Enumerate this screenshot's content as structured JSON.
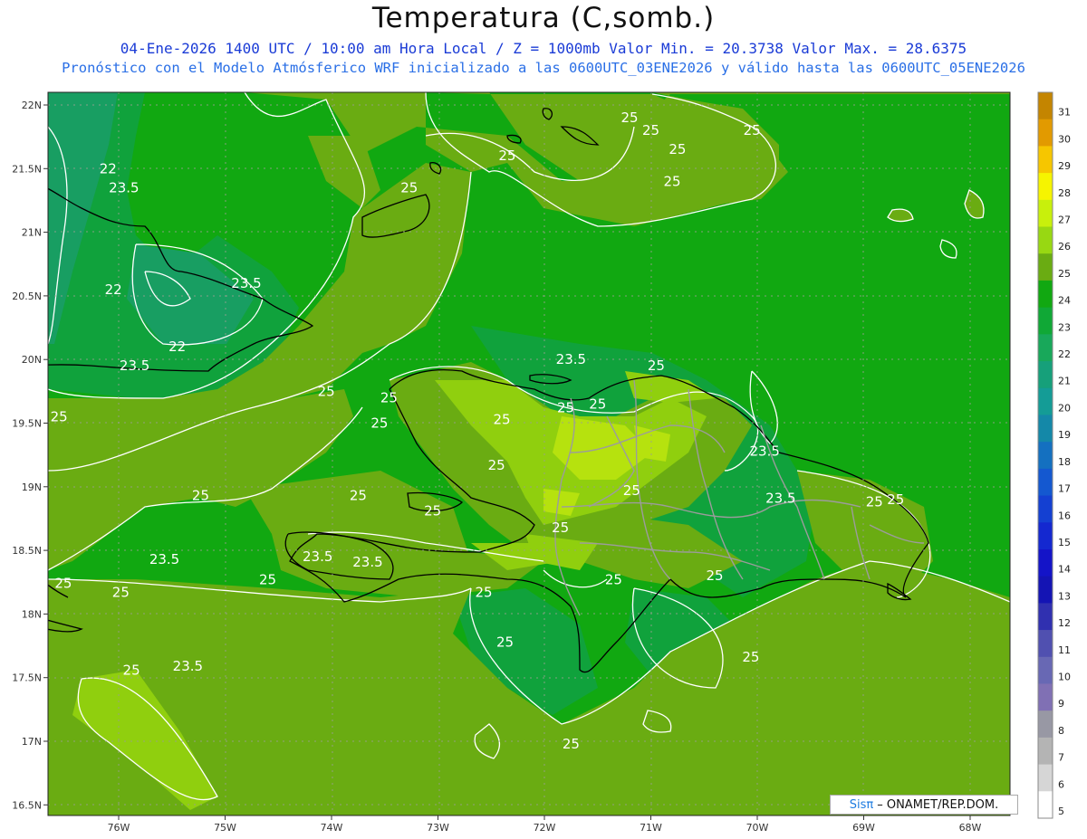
{
  "title": "Temperatura (C,somb.)",
  "subtitle_line1": "04-Ene-2026 1400 UTC / 10:00 am Hora Local / Z = 1000mb  Valor Min. = 20.3738  Valor Max. = 28.6375",
  "subtitle_line2": "Pronóstico con el Modelo Atmósferico WRF inicializado a las 0600UTC_03ENE2026 y válido hasta las  0600UTC_05ENE2026",
  "credit": {
    "sis": "Sisπ",
    "org": "– ONAMET/REP.DOM."
  },
  "colors": {
    "bg_24": "#11a811",
    "band_23": "#0fa23a",
    "band_22": "#169e5c",
    "band_25": "#6aac12",
    "band_26": "#8ccd0c",
    "band_27": "#b4e30c",
    "contour": "#ffffff",
    "coast": "#000000",
    "border": "#a0a0a0"
  },
  "chart_data": {
    "type": "heatmap",
    "variable": "Temperatura",
    "units": "C",
    "level": "1000mb",
    "valid_time": "04-Ene-2026 1400 UTC",
    "min_value": 20.3738,
    "max_value": 28.6375,
    "lon_range": [
      -76.6,
      -67.6
    ],
    "lat_range": [
      16.4,
      22.1
    ],
    "x_ticks": [
      "76W",
      "75W",
      "74W",
      "73W",
      "72W",
      "71W",
      "70W",
      "69W",
      "68W"
    ],
    "x_tick_values": [
      -76,
      -75,
      -74,
      -73,
      -72,
      -71,
      -70,
      -69,
      -68
    ],
    "y_ticks": [
      "22N",
      "21.5N",
      "21N",
      "20.5N",
      "20N",
      "19.5N",
      "19N",
      "18.5N",
      "18N",
      "17.5N",
      "17N",
      "16.5N"
    ],
    "y_tick_values": [
      22,
      21.5,
      21,
      20.5,
      20,
      19.5,
      19,
      18.5,
      18,
      17.5,
      17,
      16.5
    ],
    "contour_labels": [
      {
        "text": "25",
        "lon": -71.2,
        "lat": 21.9
      },
      {
        "text": "25",
        "lon": -70.05,
        "lat": 21.8
      },
      {
        "text": "25",
        "lon": -71.0,
        "lat": 21.8
      },
      {
        "text": "25",
        "lon": -72.35,
        "lat": 21.6
      },
      {
        "text": "25",
        "lon": -70.75,
        "lat": 21.65
      },
      {
        "text": "25",
        "lon": -70.8,
        "lat": 21.4
      },
      {
        "text": "25",
        "lon": -73.27,
        "lat": 21.35
      },
      {
        "text": "22",
        "lon": -76.1,
        "lat": 21.5
      },
      {
        "text": "23.5",
        "lon": -75.95,
        "lat": 21.35
      },
      {
        "text": "23.5",
        "lon": -74.8,
        "lat": 20.6
      },
      {
        "text": "22",
        "lon": -76.05,
        "lat": 20.55
      },
      {
        "text": "22",
        "lon": -75.45,
        "lat": 20.1
      },
      {
        "text": "23.5",
        "lon": -75.85,
        "lat": 19.95
      },
      {
        "text": "25",
        "lon": -74.05,
        "lat": 19.75
      },
      {
        "text": "25",
        "lon": -76.56,
        "lat": 19.55
      },
      {
        "text": "25",
        "lon": -73.46,
        "lat": 19.7
      },
      {
        "text": "25",
        "lon": -73.55,
        "lat": 19.5
      },
      {
        "text": "23.5",
        "lon": -71.75,
        "lat": 20.0
      },
      {
        "text": "25",
        "lon": -71.5,
        "lat": 19.65
      },
      {
        "text": "25",
        "lon": -72.4,
        "lat": 19.53
      },
      {
        "text": "25",
        "lon": -70.95,
        "lat": 19.95
      },
      {
        "text": "25",
        "lon": -71.8,
        "lat": 19.62
      },
      {
        "text": "23.5",
        "lon": -69.93,
        "lat": 19.28
      },
      {
        "text": "25",
        "lon": -72.45,
        "lat": 19.17
      },
      {
        "text": "25",
        "lon": -75.23,
        "lat": 18.93
      },
      {
        "text": "25",
        "lon": -73.75,
        "lat": 18.93
      },
      {
        "text": "25",
        "lon": -71.18,
        "lat": 18.97
      },
      {
        "text": "23.5",
        "lon": -69.78,
        "lat": 18.91
      },
      {
        "text": "25",
        "lon": -68.7,
        "lat": 18.9
      },
      {
        "text": "25",
        "lon": -68.9,
        "lat": 18.88
      },
      {
        "text": "25",
        "lon": -73.05,
        "lat": 18.81
      },
      {
        "text": "25",
        "lon": -71.85,
        "lat": 18.68
      },
      {
        "text": "23.5",
        "lon": -74.13,
        "lat": 18.45
      },
      {
        "text": "23.5",
        "lon": -73.66,
        "lat": 18.41
      },
      {
        "text": "23.5",
        "lon": -75.57,
        "lat": 18.43
      },
      {
        "text": "25",
        "lon": -76.52,
        "lat": 18.24
      },
      {
        "text": "25",
        "lon": -74.6,
        "lat": 18.27
      },
      {
        "text": "25",
        "lon": -75.98,
        "lat": 18.17
      },
      {
        "text": "25",
        "lon": -72.57,
        "lat": 18.17
      },
      {
        "text": "25",
        "lon": -71.35,
        "lat": 18.27
      },
      {
        "text": "25",
        "lon": -70.4,
        "lat": 18.3
      },
      {
        "text": "25",
        "lon": -72.37,
        "lat": 17.78
      },
      {
        "text": "25",
        "lon": -70.06,
        "lat": 17.66
      },
      {
        "text": "25",
        "lon": -75.88,
        "lat": 17.56
      },
      {
        "text": "23.5",
        "lon": -75.35,
        "lat": 17.59
      },
      {
        "text": "25",
        "lon": -71.75,
        "lat": 16.98
      }
    ]
  },
  "legend": {
    "levels": [
      "31",
      "30",
      "29",
      "28",
      "27",
      "26",
      "25",
      "24",
      "23",
      "22",
      "21",
      "20",
      "19",
      "18",
      "17",
      "16",
      "15",
      "14",
      "13",
      "12",
      "11",
      "10",
      "9",
      "8",
      "7",
      "6",
      "5"
    ],
    "colors": [
      "#c48500",
      "#e29a00",
      "#f6c600",
      "#f6f400",
      "#c8f00c",
      "#98d812",
      "#6aac12",
      "#11a811",
      "#10a836",
      "#18a85a",
      "#16a07a",
      "#149c96",
      "#1488a8",
      "#1470c0",
      "#1458d0",
      "#1440d2",
      "#1428d0",
      "#1414c8",
      "#1414b4",
      "#3030b0",
      "#5050b0",
      "#6868b4",
      "#8070b4",
      "#9898a4",
      "#b4b4b4",
      "#d6d6d6",
      "#ffffff"
    ]
  }
}
